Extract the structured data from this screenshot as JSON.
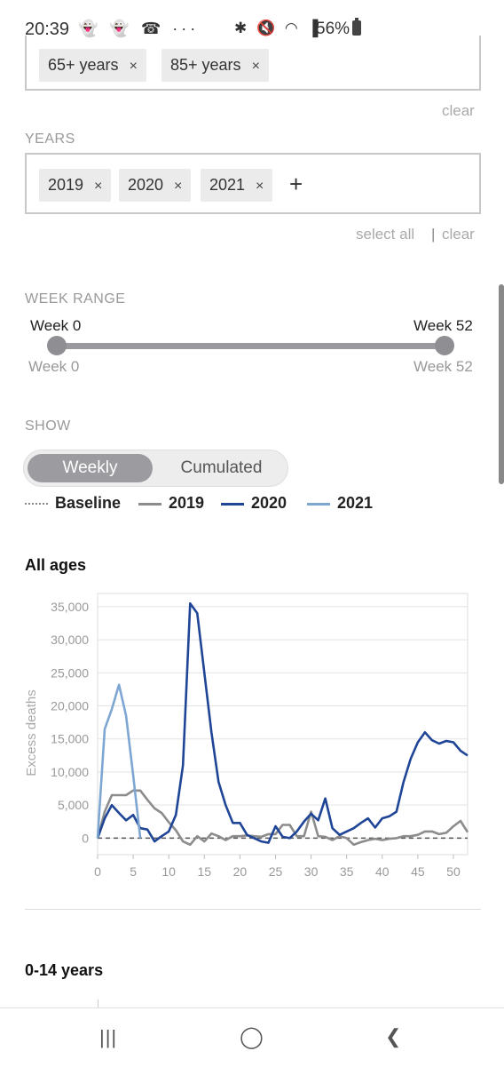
{
  "status_bar": {
    "time": "20:39",
    "left_icons": "👻 👻 ☎ ···",
    "right_icons": "✱ 🔇 ◠ ▐",
    "battery": "56%"
  },
  "age_filter": {
    "chips": [
      {
        "label": "65+ years"
      },
      {
        "label": "85+ years"
      }
    ],
    "remove_glyph": "×",
    "clear_label": "clear"
  },
  "years_filter": {
    "label": "YEARS",
    "chips": [
      {
        "label": "2019"
      },
      {
        "label": "2020"
      },
      {
        "label": "2021"
      }
    ],
    "add_glyph": "+",
    "select_all_label": "select all",
    "separator": "|",
    "clear_label": "clear"
  },
  "week_range": {
    "label": "WEEK RANGE",
    "start_value": "Week 0",
    "end_value": "Week 52",
    "min_label": "Week 0",
    "max_label": "Week 52"
  },
  "show": {
    "label": "SHOW",
    "options": [
      {
        "label": "Weekly",
        "selected": true
      },
      {
        "label": "Cumulated",
        "selected": false
      }
    ]
  },
  "legend": [
    {
      "label": "Baseline",
      "color": "#888888",
      "style": "dotted"
    },
    {
      "label": "2019",
      "color": "#8c8c8c",
      "style": "solid"
    },
    {
      "label": "2020",
      "color": "#1f4596",
      "style": "solid"
    },
    {
      "label": "2021",
      "color": "#7ea6d2",
      "style": "solid"
    }
  ],
  "chart_data": {
    "type": "line",
    "title": "All ages",
    "xlabel": "",
    "ylabel": "Excess deaths",
    "xlim": [
      0,
      52
    ],
    "ylim": [
      -2500,
      37000
    ],
    "x_ticks": [
      0,
      5,
      10,
      15,
      20,
      25,
      30,
      35,
      40,
      45,
      50
    ],
    "y_ticks": [
      0,
      5000,
      10000,
      15000,
      20000,
      25000,
      30000,
      35000
    ],
    "y_tick_labels": [
      "0",
      "5,000",
      "10,000",
      "15,000",
      "20,000",
      "25,000",
      "30,000",
      "35,000"
    ],
    "grid": true,
    "series": [
      {
        "name": "Baseline",
        "color": "#555555",
        "dashed": true,
        "x": [
          0,
          52
        ],
        "y": [
          0,
          0
        ]
      },
      {
        "name": "2019",
        "color": "#8c8c8c",
        "x": [
          0,
          1,
          2,
          3,
          4,
          5,
          6,
          7,
          8,
          9,
          10,
          11,
          12,
          13,
          14,
          15,
          16,
          17,
          18,
          19,
          20,
          21,
          22,
          23,
          24,
          25,
          26,
          27,
          28,
          29,
          30,
          31,
          32,
          33,
          34,
          35,
          36,
          37,
          38,
          39,
          40,
          41,
          42,
          43,
          44,
          45,
          46,
          47,
          48,
          49,
          50,
          51,
          52
        ],
        "y": [
          0,
          4000,
          6500,
          6500,
          6500,
          7200,
          7200,
          5800,
          4500,
          3800,
          2400,
          1200,
          -500,
          -1000,
          300,
          -500,
          700,
          300,
          -300,
          300,
          300,
          400,
          300,
          200,
          600,
          600,
          2000,
          2000,
          300,
          300,
          4000,
          300,
          200,
          -300,
          300,
          0,
          -1000,
          -600,
          -300,
          -100,
          -300,
          -100,
          0,
          300,
          300,
          500,
          1000,
          1000,
          600,
          800,
          1800,
          2600,
          900
        ]
      },
      {
        "name": "2020",
        "color": "#1f4596",
        "x": [
          0,
          1,
          2,
          3,
          4,
          5,
          6,
          7,
          8,
          9,
          10,
          11,
          12,
          13,
          14,
          15,
          16,
          17,
          18,
          19,
          20,
          21,
          22,
          23,
          24,
          25,
          26,
          27,
          28,
          29,
          30,
          31,
          32,
          33,
          34,
          35,
          36,
          37,
          38,
          39,
          40,
          41,
          42,
          43,
          44,
          45,
          46,
          47,
          48,
          49,
          50,
          51,
          52
        ],
        "y": [
          0,
          3000,
          5000,
          3800,
          2700,
          3500,
          1500,
          1300,
          -500,
          300,
          1000,
          3500,
          11000,
          35500,
          34000,
          25000,
          16000,
          8500,
          5000,
          2300,
          2300,
          500,
          0,
          -500,
          -700,
          1800,
          200,
          0,
          1000,
          2500,
          3700,
          2700,
          6000,
          1500,
          500,
          1000,
          1500,
          2300,
          3000,
          1600,
          3000,
          3300,
          4000,
          8500,
          12000,
          14500,
          16000,
          14800,
          14300,
          14700,
          14500,
          13200,
          12500
        ]
      },
      {
        "name": "2021",
        "color": "#7ea6d2",
        "x": [
          0,
          1,
          2,
          3,
          4,
          5,
          6
        ],
        "y": [
          0,
          16500,
          19500,
          23200,
          18500,
          9500,
          0
        ]
      }
    ]
  },
  "second_chart_title": "0-14 years",
  "nav_bar": {
    "recents": "|||",
    "home": "◯",
    "back": "❮"
  }
}
